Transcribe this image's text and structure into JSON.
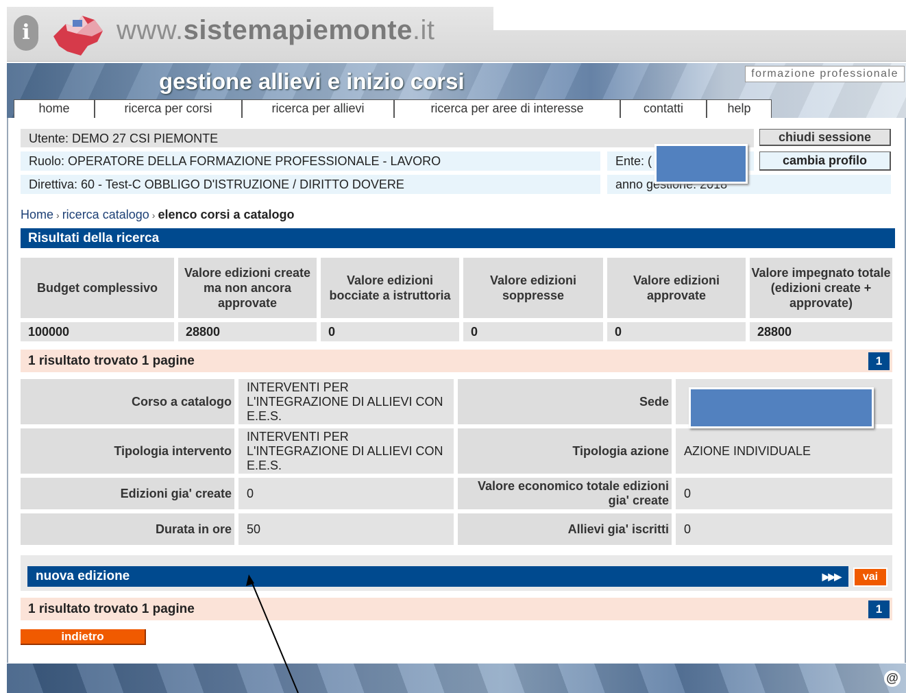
{
  "portal": {
    "info_icon": "info-icon",
    "site_prefix": "www.",
    "site_name": "sistemapiemonte",
    "site_suffix": ".it"
  },
  "banner": {
    "title": "gestione allievi e inizio corsi",
    "tag": "formazione professionale"
  },
  "nav": [
    "home",
    "ricerca per corsi",
    "ricerca per allievi",
    "ricerca per aree di interesse",
    "contatti",
    "help"
  ],
  "user": {
    "utente": "Utente: DEMO 27 CSI PIEMONTE",
    "ruolo": "Ruolo: OPERATORE DELLA FORMAZIONE PROFESSIONALE - LAVORO",
    "ente": "Ente: (",
    "direttiva": "Direttiva: 60 - Test-C OBBLIGO D'ISTRUZIONE / DIRITTO DOVERE",
    "anno": "anno gestione: 2018",
    "chiudi": "chiudi sessione",
    "cambia": "cambia profilo"
  },
  "breadcrumb": {
    "home": "Home",
    "sep": "›",
    "ricerca": "ricerca catalogo",
    "current": "elenco corsi a catalogo"
  },
  "section_title": "Risultati della ricerca",
  "budget": {
    "headers": [
      "Budget complessivo",
      "Valore edizioni create ma non ancora approvate",
      "Valore edizioni bocciate a istruttoria",
      "Valore edizioni soppresse",
      "Valore edizioni approvate",
      "Valore impegnato totale (edizioni create + approvate)"
    ],
    "values": [
      "100000",
      "28800",
      "0",
      "0",
      "0",
      "28800"
    ]
  },
  "results": {
    "text": "1 risultato trovato 1  pagine",
    "page": "1"
  },
  "details": {
    "corso_label": "Corso a catalogo",
    "corso_value": "INTERVENTI PER L'INTEGRAZIONE DI ALLIEVI CON E.E.S.",
    "sede_label": "Sede",
    "tipologia_label": "Tipologia intervento",
    "tipologia_value": "INTERVENTI PER L'INTEGRAZIONE DI ALLIEVI CON E.E.S.",
    "azione_label": "Tipologia azione",
    "azione_value": "AZIONE INDIVIDUALE",
    "edizioni_label": "Edizioni gia' create",
    "edizioni_value": "0",
    "valore_label": "Valore economico totale edizioni gia' create",
    "valore_value": "0",
    "durata_label": "Durata in ore",
    "durata_value": "50",
    "allievi_label": "Allievi gia' iscritti",
    "allievi_value": "0"
  },
  "nuova_edizione": {
    "label": "nuova edizione",
    "arrows": "▶▶▶",
    "vai": "vai"
  },
  "indietro": "indietro",
  "footer_icon": "@"
}
